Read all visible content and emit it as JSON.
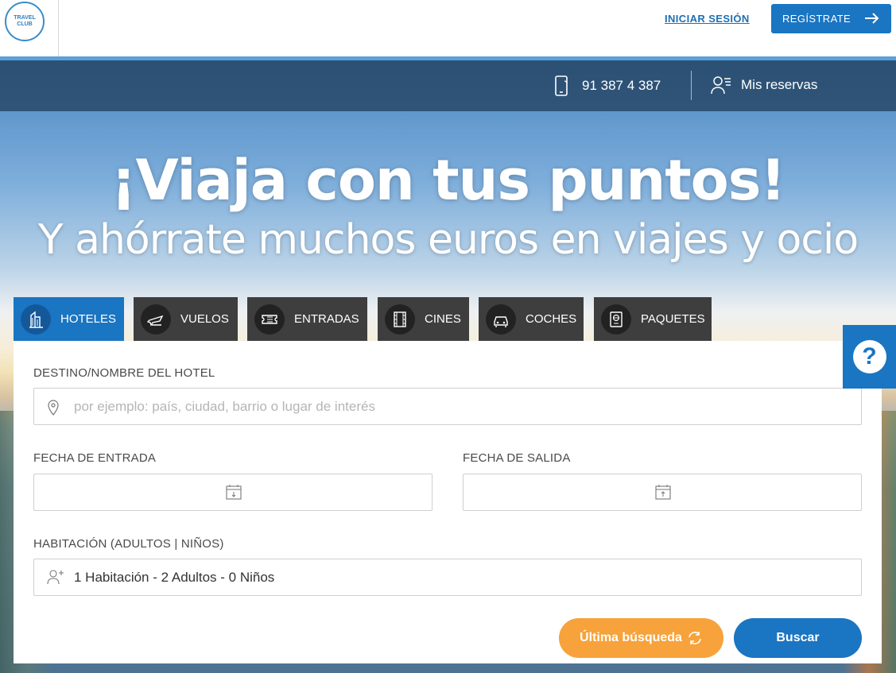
{
  "header": {
    "logo_text": "TRAVEL CLUB",
    "login_label": "INICIAR SESIÓN",
    "register_label": "REGÍSTRATE"
  },
  "nav": {
    "phone": "91 387 4 387",
    "reservations": "Mis reservas"
  },
  "hero": {
    "title": "¡Viaja con tus puntos!",
    "subtitle": "Y ahórrate muchos euros en viajes y ocio"
  },
  "tabs": [
    {
      "label": "HOTELES",
      "icon": "building-icon",
      "active": true
    },
    {
      "label": "VUELOS",
      "icon": "plane-icon",
      "active": false
    },
    {
      "label": "ENTRADAS",
      "icon": "ticket-icon",
      "active": false
    },
    {
      "label": "CINES",
      "icon": "film-icon",
      "active": false
    },
    {
      "label": "COCHES",
      "icon": "car-icon",
      "active": false
    },
    {
      "label": "PAQUETES",
      "icon": "passport-icon",
      "active": false
    }
  ],
  "form": {
    "destination_label": "DESTINO/NOMBRE DEL HOTEL",
    "destination_placeholder": "por ejemplo: país, ciudad, barrio o lugar de interés",
    "checkin_label": "FECHA DE ENTRADA",
    "checkout_label": "FECHA DE SALIDA",
    "room_label": "HABITACIÓN (ADULTOS | NIÑOS)",
    "room_value": "1 Habitación - 2 Adultos - 0 Niños",
    "last_search_label": "Última búsqueda",
    "search_label": "Buscar"
  },
  "help": {
    "label": "?"
  },
  "colors": {
    "primary": "#1a75c2",
    "accent": "#f7a23a",
    "tab_dark": "#3e3e3e"
  }
}
